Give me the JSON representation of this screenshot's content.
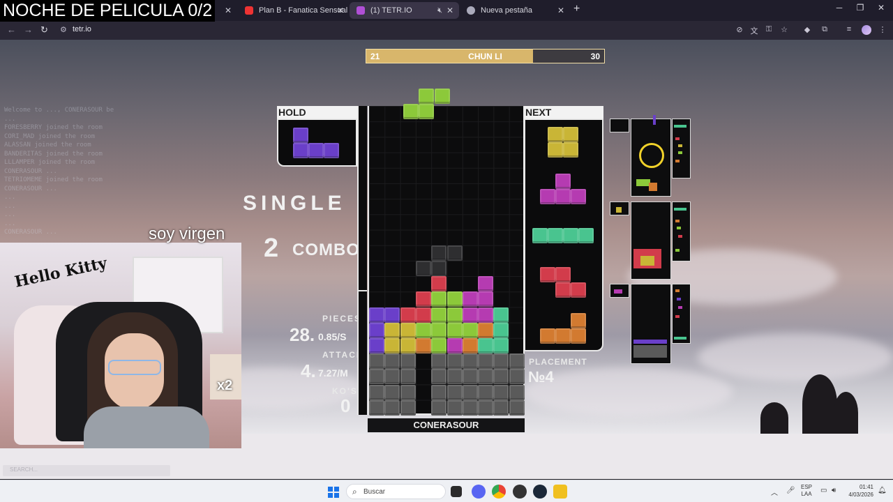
{
  "overlay": {
    "title": "NOCHE DE PELICULA 0/2",
    "caption": "soy virgen"
  },
  "browser": {
    "tabs": [
      {
        "label": "Plan B - Fanatica Sensual ft. Ni",
        "active": false
      },
      {
        "label": "(1) TETR.IO",
        "active": true
      },
      {
        "label": "Nueva pestaña",
        "active": false
      }
    ],
    "url": "tetr.io"
  },
  "game": {
    "progress": {
      "left": "21",
      "name": "CHUN LI",
      "right": "30",
      "fraction": 0.7
    },
    "hold_label": "HOLD",
    "next_label": "NEXT",
    "clear_text": "SINGLE",
    "combo_value": "2",
    "combo_label": "COMBO",
    "pieces_label": "PIECES",
    "pieces_value": "28.",
    "pieces_rate": "0.85/S",
    "attack_label": "ATTACK",
    "attack_value": "4.",
    "attack_rate": "7.27/M",
    "kos_label": "KO'S",
    "kos_value": "0",
    "placement_label": "PLACEMENT",
    "placement_value": "№4",
    "player_name": "CONERASOUR",
    "colors": {
      "I": "#49c48f",
      "O": "#c9b536",
      "T": "#b53bb1",
      "L": "#d27a30",
      "J": "#6a3fc9",
      "S": "#8cc93a",
      "Z": "#d23c4b",
      "G": "#5a5a5a"
    },
    "chat_lines": [
      "Welcome to ..., CONERASOUR be",
      "   ...",
      "FORESBERRY joined the room",
      "CORI_MAD joined the room",
      "ALASSAN joined the room",
      "BANDERITAS joined the room",
      "LLLAMPER joined the room",
      "CONERASOUR ...",
      "TETRIOMEME joined the room",
      "CONERASOUR ...",
      "...",
      "...",
      "...",
      "...",
      "CONERASOUR ..."
    ],
    "chat_input_placeholder": "SEARCH..."
  },
  "webcam": {
    "sign_text": "Hello Kitty",
    "multiplier": "x2"
  },
  "taskbar": {
    "search_placeholder": "Buscar",
    "lang_top": "ESP",
    "lang_bottom": "LAA",
    "time": "01:41",
    "date": "4/03/2026"
  }
}
